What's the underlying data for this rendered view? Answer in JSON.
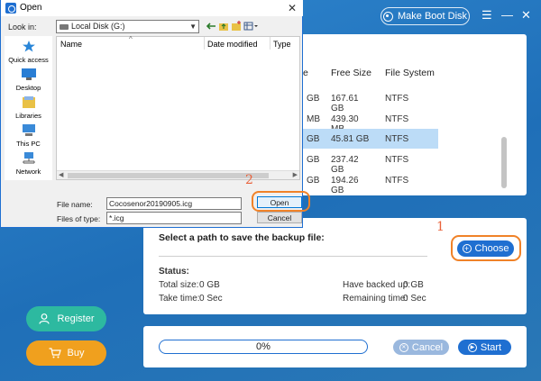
{
  "app": {
    "make_boot_disk": "Make Boot Disk",
    "menu_icon": "☰",
    "minimize_icon": "—",
    "close_icon": "✕",
    "columns": {
      "free_size": "Free Size",
      "file_system": "File System",
      "partial": "e"
    },
    "rows": [
      {
        "partial": "GB",
        "free": "167.61 GB",
        "fs": "NTFS"
      },
      {
        "partial": "MB",
        "free": "439.30 MB",
        "fs": "NTFS"
      },
      {
        "partial": "GB",
        "free": "45.81 GB",
        "fs": "NTFS",
        "selected": true
      },
      {
        "partial": "GB",
        "free": "237.42 GB",
        "fs": "NTFS"
      },
      {
        "partial": "GB",
        "free": "194.26 GB",
        "fs": "NTFS"
      }
    ],
    "path_label": "Select a path to save the backup file:",
    "choose": "Choose",
    "mark1": "1",
    "mark2": "2",
    "status_label": "Status:",
    "total_size_label": "Total size:",
    "total_size": "0 GB",
    "take_time_label": "Take time:",
    "take_time": "0 Sec",
    "backed_up_label": "Have backed up:",
    "backed_up": "0 GB",
    "remaining_label": "Remaining time:",
    "remaining": "0 Sec",
    "progress_text": "0%",
    "progress": 0,
    "cancel": "Cancel",
    "start": "Start",
    "register": "Register",
    "buy": "Buy",
    "colors": {
      "accent": "#1f6fd1",
      "highlight": "#f08228",
      "register": "#2db9a0",
      "buy": "#f0a01e"
    }
  },
  "dialog": {
    "title": "Open",
    "look_in_label": "Look in:",
    "look_in_value": "Local Disk (G:)",
    "places": [
      "Quick access",
      "Desktop",
      "Libraries",
      "This PC",
      "Network"
    ],
    "columns": {
      "name": "Name",
      "date_modified": "Date modified",
      "type": "Type"
    },
    "file_name_label": "File name:",
    "file_name_value": "Cocosenor20190905.icg",
    "file_type_label": "Files of type:",
    "file_type_value": "*.icg",
    "open": "Open",
    "cancel": "Cancel"
  }
}
